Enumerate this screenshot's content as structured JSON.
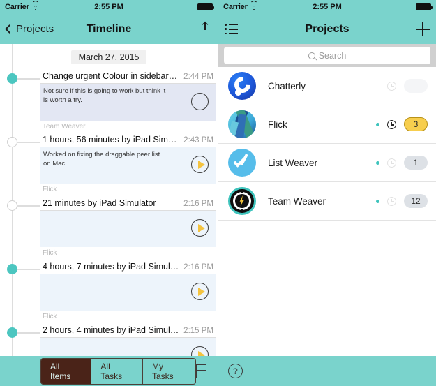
{
  "left": {
    "status": {
      "carrier": "Carrier",
      "time": "2:55 PM",
      "wifi_icon": "wifi-icon",
      "battery_icon": "battery-icon"
    },
    "nav": {
      "back_label": "Projects",
      "title": "Timeline",
      "share_icon": "share-icon",
      "back_icon": "chevron-left-icon"
    },
    "date_header": "March 27, 2015",
    "entries": [
      {
        "title": "Change urgent Colour in sidebar to...",
        "time": "2:44 PM",
        "note": "Not sure if this is going to work but think it is worth a try.",
        "project": "Team Weaver",
        "action_icon": "empty-circle-icon",
        "node": "filled",
        "card_tint": "lav"
      },
      {
        "title": "1 hours, 56 minutes by iPad Simul...",
        "time": "2:43 PM",
        "note": "Worked on fixing the draggable peer list on Mac",
        "project": "Flick",
        "action_icon": "play-icon",
        "node": "hollow",
        "card_tint": "blu"
      },
      {
        "title": "21 minutes by iPad Simulator",
        "time": "2:16 PM",
        "note": "",
        "project": "Flick",
        "action_icon": "play-icon",
        "node": "hollow",
        "card_tint": "blu"
      },
      {
        "title": "4 hours, 7 minutes by iPad Simulator",
        "time": "2:16 PM",
        "note": "",
        "project": "Flick",
        "action_icon": "play-icon",
        "node": "filled",
        "card_tint": "blu"
      },
      {
        "title": "2 hours, 4 minutes by iPad Simulator",
        "time": "2:15 PM",
        "note": "",
        "project": "",
        "action_icon": "play-icon",
        "node": "filled",
        "card_tint": "blu"
      }
    ],
    "toolbar": {
      "segments": [
        {
          "label": "All Items",
          "selected": true
        },
        {
          "label": "All Tasks",
          "selected": false
        },
        {
          "label": "My Tasks",
          "selected": false
        }
      ],
      "flag_icon": "flag-icon"
    }
  },
  "right": {
    "status": {
      "carrier": "Carrier",
      "time": "2:55 PM",
      "wifi_icon": "wifi-icon",
      "battery_icon": "battery-icon"
    },
    "nav": {
      "title": "Projects",
      "list_icon": "list-icon",
      "add_icon": "plus-icon"
    },
    "search": {
      "placeholder": "Search",
      "value": "",
      "icon": "search-icon"
    },
    "projects": [
      {
        "name": "Chatterly",
        "icon": "chatterly-app-icon",
        "dot": false,
        "clock": "dim",
        "badge": "",
        "badge_style": "dim"
      },
      {
        "name": "Flick",
        "icon": "flick-app-icon",
        "dot": true,
        "clock": "active",
        "badge": "3",
        "badge_style": "yellow"
      },
      {
        "name": "List Weaver",
        "icon": "listweaver-app-icon",
        "dot": true,
        "clock": "dim",
        "badge": "1",
        "badge_style": "grey"
      },
      {
        "name": "Team Weaver",
        "icon": "teamweaver-app-icon",
        "dot": true,
        "clock": "dim",
        "badge": "12",
        "badge_style": "grey"
      }
    ],
    "toolbar": {
      "help_label": "?",
      "help_icon": "help-icon"
    }
  },
  "colors": {
    "teal_bar": "#7ad3cc",
    "node_teal": "#4cc6c0",
    "card_lavender": "#e3e7f3",
    "card_blue": "#edf4fb",
    "play_yellow": "#f4c33f",
    "badge_yellow": "#f7ce4e",
    "segment_selected": "#4a2318"
  }
}
